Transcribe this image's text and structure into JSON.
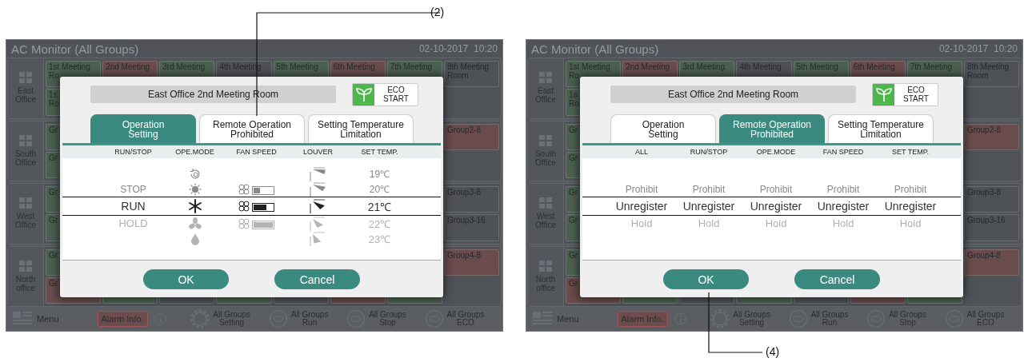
{
  "screens": [
    {
      "title": "AC Monitor (All Groups)",
      "datetime": "02-10-2017  10:20",
      "callout": {
        "label": "(2)",
        "kind": "top"
      },
      "offices": [
        {
          "name": "East\nOffice",
          "rows": [
            {
              "tiles": [
                {
                  "label": "1st Meeting\nRo",
                  "color": "#4b6050"
                },
                {
                  "label": "2nd Meeting",
                  "color": "#6a4c4d"
                },
                {
                  "label": "3rd Meeting",
                  "color": "#4b6050"
                },
                {
                  "label": "4th Meeting",
                  "color": "#4e5156"
                },
                {
                  "label": "5th Meeting",
                  "color": "#4b6050"
                },
                {
                  "label": "6th Meeting",
                  "color": "#6a4c4d"
                },
                {
                  "label": "7th Meeting",
                  "color": "#4b6050"
                },
                {
                  "label": "8th Meeting\nRoom",
                  "color": "#4e5156"
                }
              ]
            },
            {
              "first": {
                "label": "1s\nRo",
                "color": "#4b6050"
              }
            }
          ]
        },
        {
          "name": "South\nOffice",
          "rows": [
            {
              "first": {
                "label": "Gr",
                "color": "#4b6050"
              },
              "last": {
                "label": "Group2-8",
                "color": "#6a4c4d"
              }
            },
            {
              "first": {
                "label": "Gr",
                "color": "#4b6050"
              }
            }
          ]
        },
        {
          "name": "West\nOffice",
          "rows": [
            {
              "first": {
                "label": "Gr",
                "color": "#4b6050"
              },
              "last": {
                "label": "Group3-8",
                "color": "#4e5156"
              }
            },
            {
              "first": {
                "label": "Gr",
                "color": "#4b6050"
              },
              "last": {
                "label": "Group3-16",
                "color": "#4e5156"
              }
            }
          ]
        },
        {
          "name": "North\noffice",
          "rows": [
            {
              "first": {
                "label": "Gr",
                "color": "#4b6050"
              },
              "last": {
                "label": "Group4-8",
                "color": "#6a4c4d"
              }
            },
            {
              "tiles": [
                {
                  "label": "Gr",
                  "color": "#6a4c4d"
                },
                {
                  "color": "#4b6050"
                },
                {
                  "color": "#4e5156"
                },
                {
                  "color": "#4b6050"
                },
                {
                  "color": "#4e5156"
                },
                {
                  "color": "#6a4c4d"
                },
                {
                  "color": "#4b6050"
                }
              ]
            }
          ]
        }
      ],
      "bottom_bar": {
        "menu": "Menu",
        "alarm": "Alarm Info.",
        "actions": [
          {
            "kind": "gear",
            "label": "All Groups\nSetting"
          },
          {
            "kind": "circle",
            "label": "All Groups\nRun"
          },
          {
            "kind": "circle",
            "label": "All Groups\nStop"
          },
          {
            "kind": "circle",
            "label": "All Groups\nECO"
          }
        ]
      },
      "dialog": {
        "name": "East Office 2nd Meeting Room",
        "eco": "ECO\nSTART",
        "tabs": [
          {
            "label": "Operation\nSetting",
            "selected": true
          },
          {
            "label": "Remote Operation\nProhibited",
            "selected": false
          },
          {
            "label": "Setting Temperature\nLimitation",
            "selected": false
          }
        ],
        "columns": [
          {
            "header": "RUN/STOP",
            "items": [
              {
                "kind": "text",
                "text": "STOP",
                "selected": false
              },
              {
                "kind": "text",
                "text": "RUN",
                "selected": true
              },
              {
                "kind": "text",
                "text": "HOLD",
                "selected": false
              }
            ]
          },
          {
            "header": "OPE.MODE",
            "items": [
              {
                "kind": "auto",
                "selected": false
              },
              {
                "kind": "heat",
                "selected": false
              },
              {
                "kind": "cool",
                "selected": true
              },
              {
                "kind": "fan",
                "selected": false
              },
              {
                "kind": "dry",
                "selected": false
              }
            ]
          },
          {
            "header": "FAN SPEED",
            "items": [
              {
                "kind": "fan-speed",
                "level": 0.33,
                "selected": false
              },
              {
                "kind": "fan-speed",
                "level": 0.67,
                "selected": true
              },
              {
                "kind": "fan-speed",
                "level": 1,
                "selected": false
              }
            ]
          },
          {
            "header": "LOUVER",
            "items": [
              {
                "kind": "horizontal",
                "selected": false
              },
              {
                "kind": "slight",
                "selected": false
              },
              {
                "kind": "middle",
                "selected": true
              },
              {
                "kind": "low",
                "selected": false
              },
              {
                "kind": "down",
                "selected": false
              }
            ]
          },
          {
            "header": "SET TEMP.",
            "items": [
              {
                "kind": "text",
                "text": "19℃",
                "selected": false
              },
              {
                "kind": "text",
                "text": "20℃",
                "selected": false
              },
              {
                "kind": "text",
                "text": "21℃",
                "selected": true
              },
              {
                "kind": "text",
                "text": "22℃",
                "selected": false
              },
              {
                "kind": "text",
                "text": "23℃",
                "selected": false
              }
            ]
          }
        ],
        "buttons": [
          "OK",
          "Cancel"
        ]
      }
    },
    {
      "title": "AC Monitor (All Groups)",
      "datetime": "02-10-2017  10:20",
      "callout": {
        "label": "(4)",
        "kind": "bottom"
      },
      "offices": [
        {
          "name": "East\nOffice",
          "rows": [
            {
              "tiles": [
                {
                  "label": "1st Meeting\nRo",
                  "color": "#4b6050"
                },
                {
                  "label": "2nd Meeting",
                  "color": "#6a4c4d"
                },
                {
                  "label": "3rd Meeting",
                  "color": "#4b6050"
                },
                {
                  "label": "4th Meeting",
                  "color": "#4e5156"
                },
                {
                  "label": "5th Meeting",
                  "color": "#4b6050"
                },
                {
                  "label": "6th Meeting",
                  "color": "#6a4c4d"
                },
                {
                  "label": "7th Meeting",
                  "color": "#4b6050"
                },
                {
                  "label": "8th Meeting\nRoom",
                  "color": "#4e5156"
                }
              ]
            },
            {
              "first": {
                "label": "1s\nRo",
                "color": "#4b6050"
              }
            }
          ]
        },
        {
          "name": "South\nOffice",
          "rows": [
            {
              "first": {
                "label": "Gr",
                "color": "#4b6050"
              },
              "last": {
                "label": "Group2-8",
                "color": "#6a4c4d"
              }
            },
            {
              "first": {
                "label": "Gr",
                "color": "#4b6050"
              }
            }
          ]
        },
        {
          "name": "West\nOffice",
          "rows": [
            {
              "first": {
                "label": "Gr",
                "color": "#4b6050"
              },
              "last": {
                "label": "Group3-8",
                "color": "#4e5156"
              }
            },
            {
              "first": {
                "label": "Gr",
                "color": "#4b6050"
              },
              "last": {
                "label": "Group3-16",
                "color": "#4e5156"
              }
            }
          ]
        },
        {
          "name": "North\noffice",
          "rows": [
            {
              "first": {
                "label": "Gr",
                "color": "#4b6050"
              },
              "last": {
                "label": "Group4-8",
                "color": "#6a4c4d"
              }
            },
            {
              "tiles": [
                {
                  "label": "Gr",
                  "color": "#6a4c4d"
                },
                {
                  "color": "#4b6050"
                },
                {
                  "color": "#4e5156"
                },
                {
                  "color": "#4b6050"
                },
                {
                  "color": "#4e5156"
                },
                {
                  "color": "#6a4c4d"
                },
                {
                  "color": "#4b6050"
                }
              ]
            }
          ]
        }
      ],
      "bottom_bar": {
        "menu": "Menu",
        "alarm": "Alarm Info.",
        "actions": [
          {
            "kind": "gear",
            "label": "All Groups\nSetting"
          },
          {
            "kind": "circle",
            "label": "All Groups\nRun"
          },
          {
            "kind": "circle",
            "label": "All Groups\nStop"
          },
          {
            "kind": "circle",
            "label": "All Groups\nECO"
          }
        ]
      },
      "dialog": {
        "name": "East Office 2nd Meeting Room",
        "eco": "ECO\nSTART",
        "tabs": [
          {
            "label": "Operation\nSetting",
            "selected": false
          },
          {
            "label": "Remote Operation\nProhibited",
            "selected": true
          },
          {
            "label": "Setting Temperature\nLimitation",
            "selected": false
          }
        ],
        "columns": [
          {
            "header": "ALL",
            "items": [
              {
                "kind": "text",
                "text": "Prohibit",
                "selected": false
              },
              {
                "kind": "text",
                "text": "Unregister",
                "selected": true
              },
              {
                "kind": "text",
                "text": "Hold",
                "selected": false
              }
            ]
          },
          {
            "header": "RUN/STOP",
            "items": [
              {
                "kind": "text",
                "text": "Prohibit",
                "selected": false
              },
              {
                "kind": "text",
                "text": "Unregister",
                "selected": true
              },
              {
                "kind": "text",
                "text": "Hold",
                "selected": false
              }
            ]
          },
          {
            "header": "OPE.MODE",
            "items": [
              {
                "kind": "text",
                "text": "Prohibit",
                "selected": false
              },
              {
                "kind": "text",
                "text": "Unregister",
                "selected": true
              },
              {
                "kind": "text",
                "text": "Hold",
                "selected": false
              }
            ]
          },
          {
            "header": "FAN SPEED",
            "items": [
              {
                "kind": "text",
                "text": "Prohibit",
                "selected": false
              },
              {
                "kind": "text",
                "text": "Unregister",
                "selected": true
              },
              {
                "kind": "text",
                "text": "Hold",
                "selected": false
              }
            ]
          },
          {
            "header": "SET TEMP.",
            "items": [
              {
                "kind": "text",
                "text": "Prohibit",
                "selected": false
              },
              {
                "kind": "text",
                "text": "Unregister",
                "selected": true
              },
              {
                "kind": "text",
                "text": "Hold",
                "selected": false
              }
            ]
          }
        ],
        "buttons": [
          "OK",
          "Cancel"
        ]
      }
    }
  ]
}
